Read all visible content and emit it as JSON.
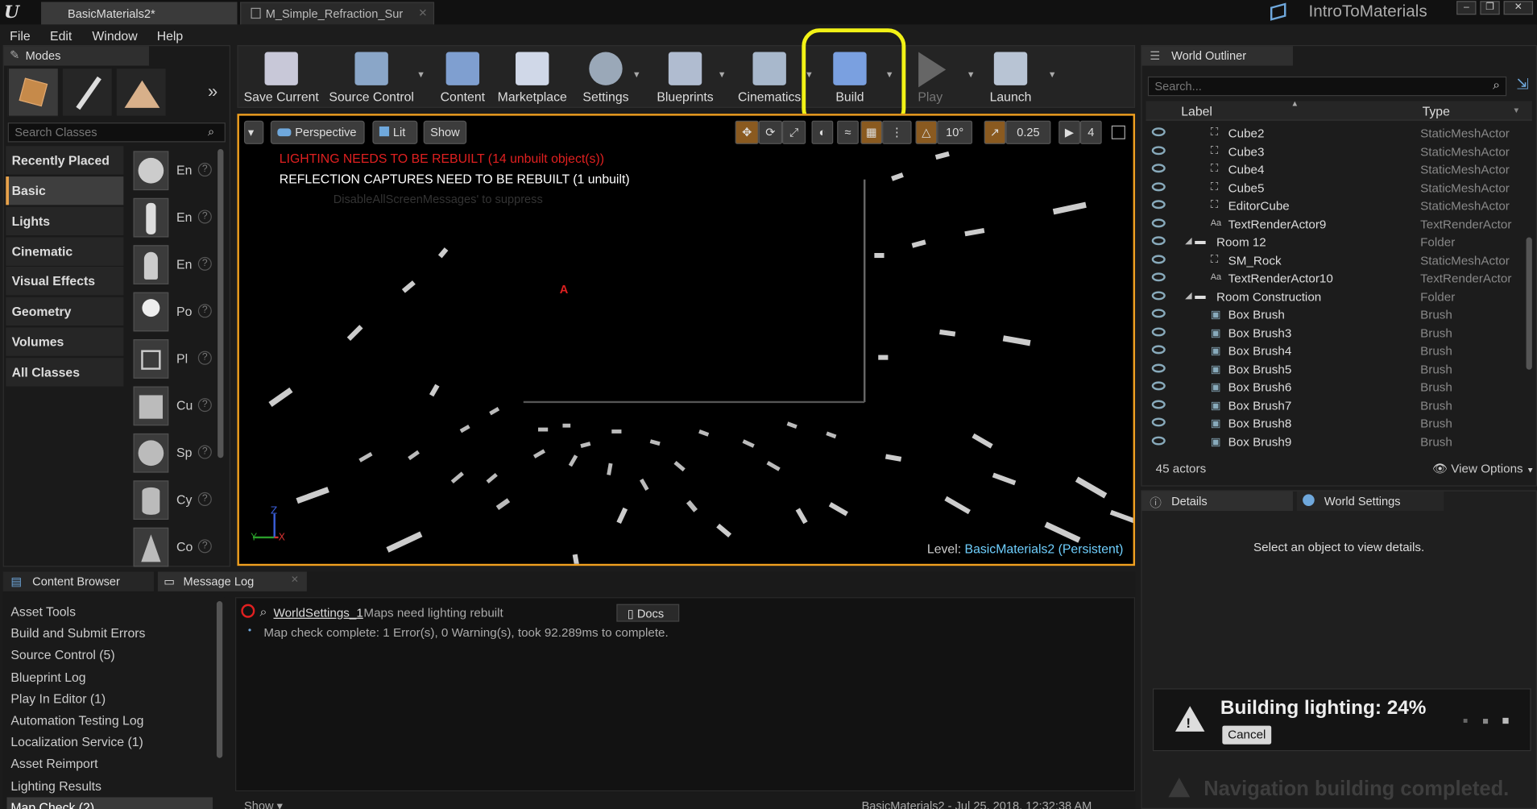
{
  "titlebar": {
    "tabs": [
      "BasicMaterials2*",
      "M_Simple_Refraction_Sur"
    ],
    "project": "IntroToMaterials",
    "window_buttons": [
      "–",
      "❐",
      "✕"
    ]
  },
  "menu": [
    "File",
    "Edit",
    "Window",
    "Help"
  ],
  "modes": {
    "tab_label": "Modes",
    "search_placeholder": "Search Classes",
    "categories": [
      "Recently Placed",
      "Basic",
      "Lights",
      "Cinematic",
      "Visual Effects",
      "Geometry",
      "Volumes",
      "All Classes"
    ],
    "active_category": "Basic",
    "class_items": [
      "En",
      "En",
      "En",
      "Po",
      "Pl",
      "Cu",
      "Sp",
      "Cy",
      "Co"
    ]
  },
  "toolbar": {
    "buttons": [
      "Save Current",
      "Source Control",
      "Content",
      "Marketplace",
      "Settings",
      "Blueprints",
      "Cinematics",
      "Build",
      "Play",
      "Launch"
    ],
    "highlighted": "Build"
  },
  "viewport": {
    "perspective_label": "Perspective",
    "lit_label": "Lit",
    "show_label": "Show",
    "rotation_snap": "10°",
    "scale_snap": "0.25",
    "camera_speed": "4",
    "msg_lighting": "LIGHTING NEEDS TO BE REBUILT (14 unbuilt object(s))",
    "msg_reflection": "REFLECTION CAPTURES NEED TO BE REBUILT (1 unbuilt)",
    "msg_suppress": "DisableAllScreenMessages' to suppress",
    "marker": "A",
    "level_prefix": "Level:",
    "level_name": "BasicMaterials2 (Persistent)"
  },
  "outliner": {
    "tab_label": "World Outliner",
    "search_placeholder": "Search...",
    "col_label": "Label",
    "col_type": "Type",
    "rows": [
      {
        "label": "Cube2",
        "type": "StaticMeshActor",
        "kind": "mesh"
      },
      {
        "label": "Cube3",
        "type": "StaticMeshActor",
        "kind": "mesh"
      },
      {
        "label": "Cube4",
        "type": "StaticMeshActor",
        "kind": "mesh"
      },
      {
        "label": "Cube5",
        "type": "StaticMeshActor",
        "kind": "mesh"
      },
      {
        "label": "EditorCube",
        "type": "StaticMeshActor",
        "kind": "mesh"
      },
      {
        "label": "TextRenderActor9",
        "type": "TextRenderActor",
        "kind": "text"
      },
      {
        "label": "Room 12",
        "type": "Folder",
        "kind": "folder"
      },
      {
        "label": "SM_Rock",
        "type": "StaticMeshActor",
        "kind": "mesh"
      },
      {
        "label": "TextRenderActor10",
        "type": "TextRenderActor",
        "kind": "text"
      },
      {
        "label": "Room Construction",
        "type": "Folder",
        "kind": "folder"
      },
      {
        "label": "Box Brush",
        "type": "Brush",
        "kind": "brush"
      },
      {
        "label": "Box Brush3",
        "type": "Brush",
        "kind": "brush"
      },
      {
        "label": "Box Brush4",
        "type": "Brush",
        "kind": "brush"
      },
      {
        "label": "Box Brush5",
        "type": "Brush",
        "kind": "brush"
      },
      {
        "label": "Box Brush6",
        "type": "Brush",
        "kind": "brush"
      },
      {
        "label": "Box Brush7",
        "type": "Brush",
        "kind": "brush"
      },
      {
        "label": "Box Brush8",
        "type": "Brush",
        "kind": "brush"
      },
      {
        "label": "Box Brush9",
        "type": "Brush",
        "kind": "brush"
      }
    ],
    "actor_count": "45 actors",
    "view_options": "View Options"
  },
  "details": {
    "tab_details": "Details",
    "tab_world": "World Settings",
    "empty_text": "Select an object to view details."
  },
  "notification": {
    "title": "Building lighting:",
    "percent": "24%",
    "cancel": "Cancel",
    "faded": "Navigation building completed."
  },
  "bottom": {
    "tab_content": "Content Browser",
    "tab_log": "Message Log",
    "log_items": [
      "Asset Tools",
      "Build and Submit Errors",
      "Source Control (5)",
      "Blueprint Log",
      "Play In Editor (1)",
      "Automation Testing Log",
      "Localization Service (1)",
      "Asset Reimport",
      "Lighting Results",
      "Map Check (2)"
    ],
    "active_log": "Map Check (2)",
    "msg1_link": "WorldSettings_1",
    "msg1_text": "Maps need lighting rebuilt",
    "docs_label": "Docs",
    "msg2_text": "Map check complete: 1 Error(s), 0 Warning(s), took 92.289ms to complete.",
    "show_label": "Show",
    "footer_text": "BasicMaterials2 - Jul 25, 2018, 12:32:38 AM"
  },
  "colors": {
    "accent": "#f0a020",
    "highlight": "#f2f216",
    "error": "#e02020",
    "link": "#6fd0ff"
  }
}
